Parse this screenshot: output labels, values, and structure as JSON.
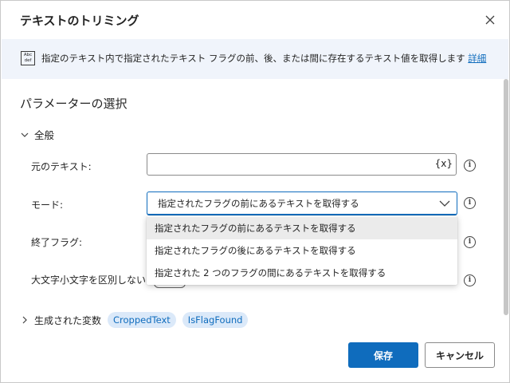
{
  "dialog": {
    "title": "テキストのトリミング",
    "close_icon": "close-icon"
  },
  "banner": {
    "icon_line1": "Abc",
    "icon_line2": "def",
    "text": "指定のテキスト内で指定されたテキスト フラグの前、後、または間に存在するテキスト値を取得します",
    "link": "詳細"
  },
  "parameters": {
    "section_title": "パラメーターの選択",
    "group_label": "全般",
    "fields": {
      "original_text": {
        "label": "元のテキスト:",
        "value": "",
        "variable_button": "{x}"
      },
      "mode": {
        "label": "モード:",
        "selected": "指定されたフラグの前にあるテキストを取得する",
        "options": [
          "指定されたフラグの前にあるテキストを取得する",
          "指定されたフラグの後にあるテキストを取得する",
          "指定された 2 つのフラグの間にあるテキストを取得する"
        ]
      },
      "end_flag": {
        "label": "終了フラグ:"
      },
      "ignore_case": {
        "label": "大文字小文字を区別しない:"
      }
    }
  },
  "generated_variables": {
    "label": "生成された変数",
    "chips": [
      "CroppedText",
      "IsFlagFound"
    ]
  },
  "footer": {
    "save": "保存",
    "cancel": "キャンセル"
  },
  "colors": {
    "accent": "#0f6cbd",
    "banner_bg": "#f0f4fb",
    "chip_bg": "#dbe9f9"
  }
}
